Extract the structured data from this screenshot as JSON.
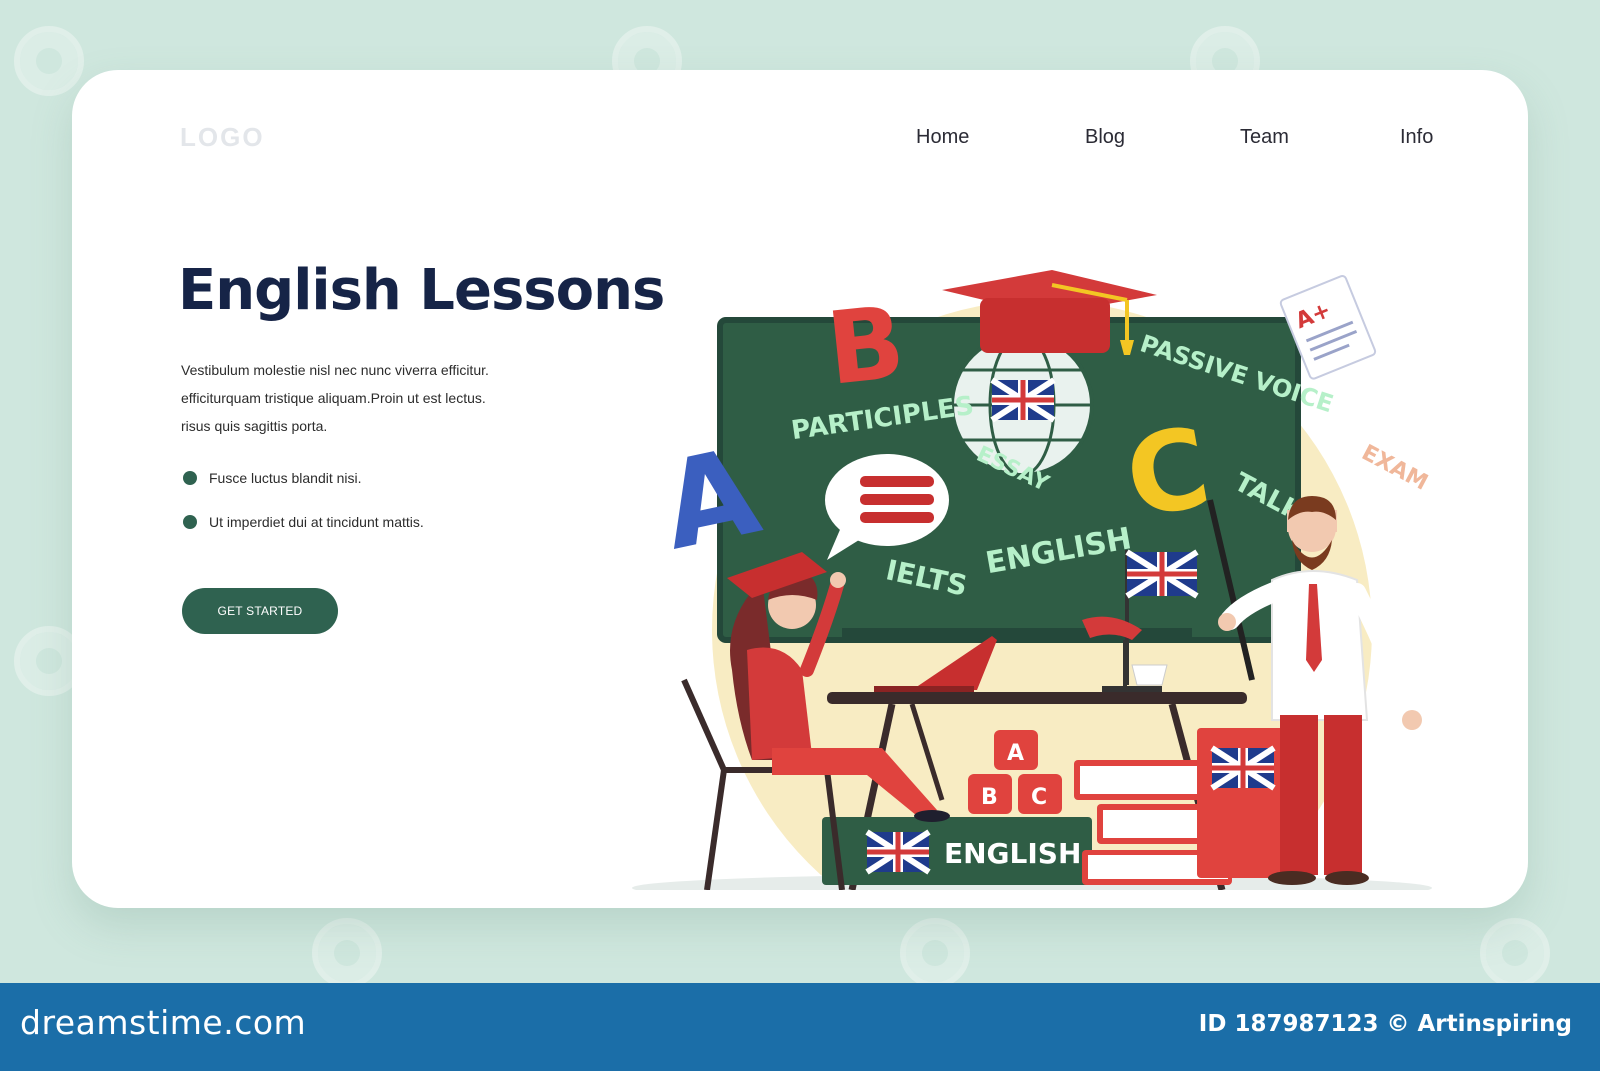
{
  "header": {
    "logo": "LOGO",
    "nav": [
      {
        "label": "Home"
      },
      {
        "label": "Blog"
      },
      {
        "label": "Team"
      },
      {
        "label": "Info"
      }
    ]
  },
  "hero": {
    "title": "English Lessons",
    "paragraph_lines": [
      "Vestibulum molestie nisl nec nunc viverra efficitur.",
      "efficiturquam tristique aliquam.Proin ut est lectus.",
      "risus quis sagittis porta."
    ],
    "bullets": [
      "Fusce luctus blandit nisi.",
      "Ut imperdiet dui at tincidunt mattis."
    ],
    "cta_label": "GET STARTED"
  },
  "illustration": {
    "board_words": [
      "PARTICIPLES",
      "PASSIVE VOICE",
      "ESSAY",
      "ENGLISH",
      "TALK",
      "IELTS"
    ],
    "letters": [
      "A",
      "B",
      "C"
    ],
    "exam_label": "EXAM",
    "grade_label": "A+",
    "book_label": "ENGLISH",
    "blocks": [
      "A",
      "B",
      "C"
    ]
  },
  "footer": {
    "brand": "dreamstime.com",
    "id_text": "ID 187987123 © Artinspiring"
  },
  "colors": {
    "background": "#cfe7de",
    "card": "#ffffff",
    "accent_green": "#2f6250",
    "title_navy": "#162447",
    "board": "#2f5d45",
    "red": "#d33a3a",
    "footer_blue": "#1b6ea8"
  }
}
